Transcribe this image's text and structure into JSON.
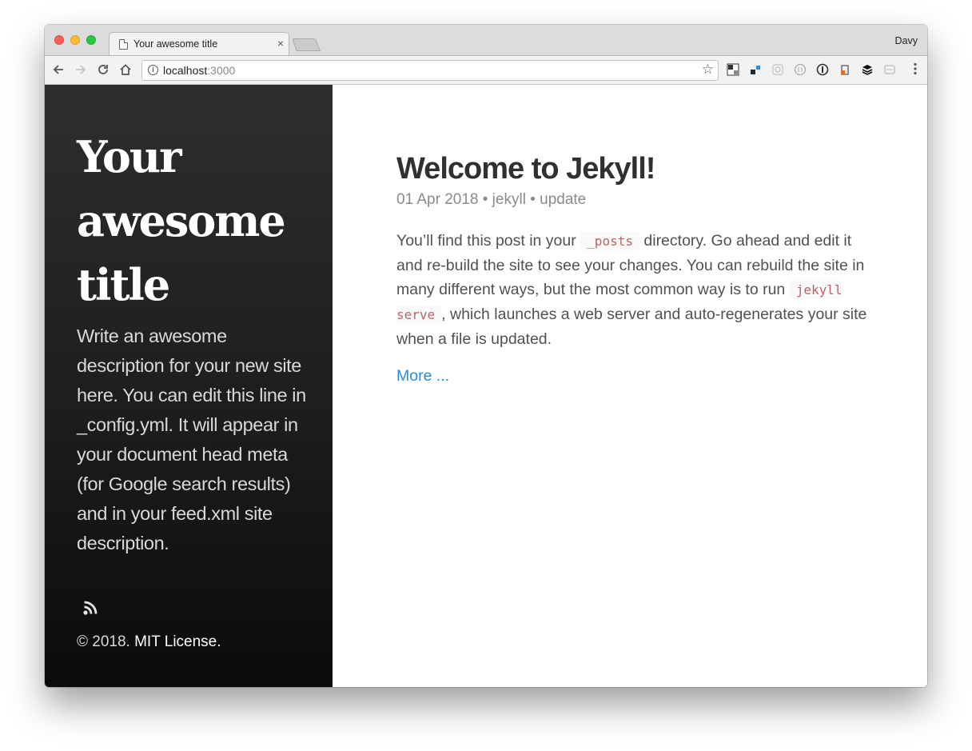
{
  "browser": {
    "tab_title": "Your awesome title",
    "tab_close": "×",
    "profile_name": "Davy",
    "url_host": "localhost",
    "url_port": ":3000",
    "info_icon": "i",
    "bookmark_star": "☆"
  },
  "sidebar": {
    "title_lines": [
      "Your",
      "awesome",
      "title"
    ],
    "description": "Write an awesome description for your new site here. You can edit this line in _config.yml. It will appear in your document head meta (for Google search results) and in your feed.xml site description.",
    "copyright": "© 2018. ",
    "license": "MIT License."
  },
  "post": {
    "title": "Welcome to Jekyll!",
    "meta": "01 Apr 2018 • jekyll • update",
    "body_1": "You’ll find this post in your ",
    "code_1": "_posts",
    "body_2": " directory. Go ahead and edit it and re-build the site to see your changes. You can rebuild the site in many different ways, but the most common way is to run ",
    "code_2": "jekyll serve",
    "body_3": ", which launches a web server and auto-regenerates your site when a file is updated.",
    "more": "More ..."
  },
  "colors": {
    "link": "#268bd2",
    "code": "#bf616a",
    "sidebar_bg": "#202020"
  },
  "icons": [
    "back-icon",
    "forward-icon",
    "reload-icon",
    "home-icon",
    "info-icon",
    "star-icon",
    "rss-icon",
    "menu-icon"
  ]
}
